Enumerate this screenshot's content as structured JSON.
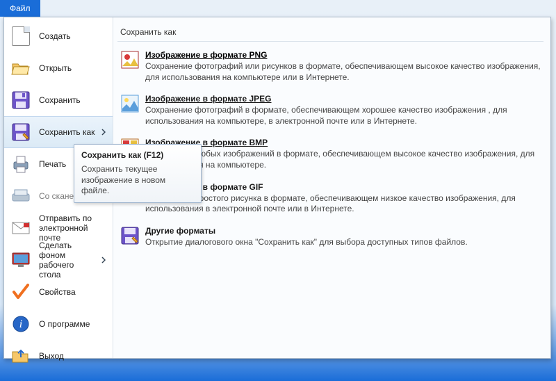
{
  "ribbon": {
    "file_tab": "Файл"
  },
  "menu": {
    "create": "Создать",
    "open": "Открыть",
    "save": "Сохранить",
    "save_as": "Сохранить как",
    "print": "Печать",
    "from_scanner": "Со сканер...",
    "send_mail": "Отправить по электронной почте",
    "set_desktop": "Сделать фоном рабочего стола",
    "properties": "Свойства",
    "about": "О программе",
    "exit": "Выход"
  },
  "right": {
    "header": "Сохранить как",
    "items": [
      {
        "title": "Изображение в формате PNG",
        "desc": "Сохранение фотографий или рисунков в формате, обеспечивающем высокое качество изображения, для использования на компьютере или в Интернете."
      },
      {
        "title": "Изображение в формате JPEG",
        "desc": "Сохранение фотографий в формате, обеспечивающем хорошее качество изображения , для использования на компьютере, в электронной почте или в Интернете."
      },
      {
        "title": "Изображение в формате BMP",
        "desc": "Сохранение любых изображений в формате, обеспечивающем высокое качество изображения, для использования на компьютере."
      },
      {
        "title": "Изображение в формате GIF",
        "desc": "Сохранение простого рисунка в формате, обеспечивающем низкое качество изображения, для использования в электронной почте или в Интернете."
      },
      {
        "title": "Другие форматы",
        "desc": "Открытие диалогового окна \"Сохранить как\" для выбора доступных типов файлов."
      }
    ]
  },
  "tooltip": {
    "title": "Сохранить как (F12)",
    "body": "Сохранить текущее изображение в новом файле."
  }
}
